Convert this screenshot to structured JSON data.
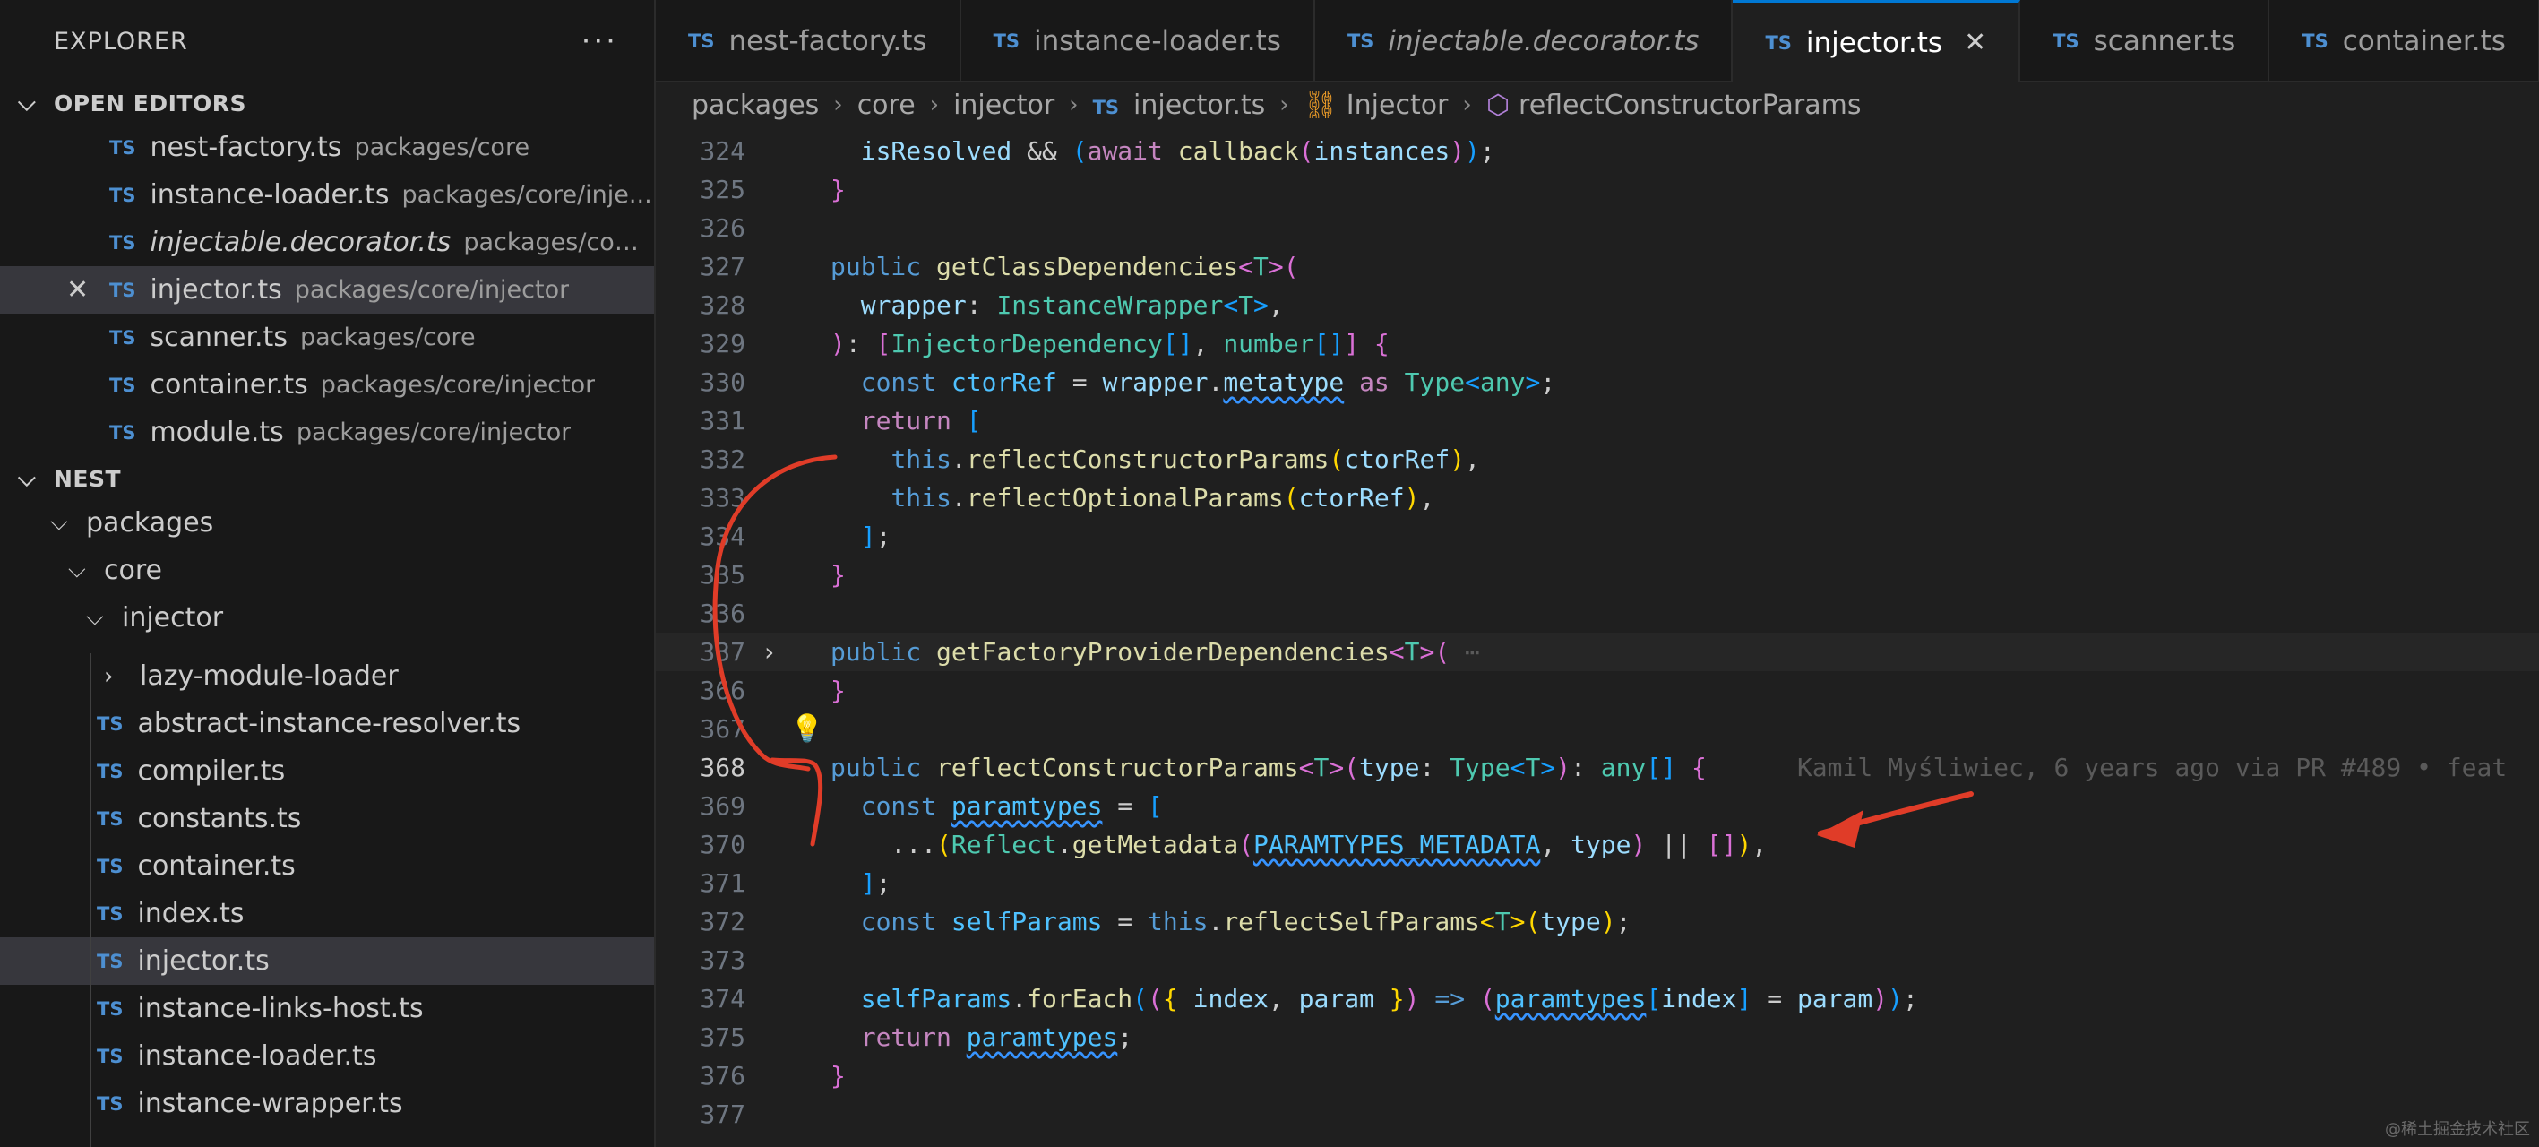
{
  "sidebar": {
    "title": "EXPLORER",
    "more": "···",
    "open_editors": {
      "label": "OPEN EDITORS",
      "items": [
        {
          "name": "nest-factory.ts",
          "path": "packages/core",
          "italic": false,
          "active": false
        },
        {
          "name": "instance-loader.ts",
          "path": "packages/core/inje...",
          "italic": false,
          "active": false
        },
        {
          "name": "injectable.decorator.ts",
          "path": "packages/com...",
          "italic": true,
          "active": false
        },
        {
          "name": "injector.ts",
          "path": "packages/core/injector",
          "italic": false,
          "active": true
        },
        {
          "name": "scanner.ts",
          "path": "packages/core",
          "italic": false,
          "active": false
        },
        {
          "name": "container.ts",
          "path": "packages/core/injector",
          "italic": false,
          "active": false
        },
        {
          "name": "module.ts",
          "path": "packages/core/injector",
          "italic": false,
          "active": false
        }
      ]
    },
    "workspace": {
      "label": "NEST",
      "folders": [
        "packages",
        "core",
        "injector"
      ],
      "subfolder": "lazy-module-loader",
      "files": [
        "abstract-instance-resolver.ts",
        "compiler.ts",
        "constants.ts",
        "container.ts",
        "index.ts",
        "injector.ts",
        "instance-links-host.ts",
        "instance-loader.ts",
        "instance-wrapper.ts"
      ],
      "active_file": "injector.ts"
    },
    "ts_badge": "TS"
  },
  "tabs": [
    {
      "label": "nest-factory.ts",
      "italic": false,
      "active": false
    },
    {
      "label": "instance-loader.ts",
      "italic": false,
      "active": false
    },
    {
      "label": "injectable.decorator.ts",
      "italic": true,
      "active": false
    },
    {
      "label": "injector.ts",
      "italic": false,
      "active": true
    },
    {
      "label": "scanner.ts",
      "italic": false,
      "active": false
    },
    {
      "label": "container.ts",
      "italic": false,
      "active": false
    }
  ],
  "breadcrumb": [
    "packages",
    "core",
    "injector",
    "injector.ts",
    "Injector",
    "reflectConstructorParams"
  ],
  "editor": {
    "current_line": 368,
    "lines": [
      {
        "n": 324,
        "html": "  <span class='vr'>isResolved</span> &amp;&amp; <span class='pb'>(</span><span class='kw2'>await</span> <span class='fn'>callback</span><span class='pn'>(</span><span class='vr'>instances</span><span class='pn'>)</span><span class='pb'>)</span>;"
      },
      {
        "n": 325,
        "html": "<span class='pn'>}</span>"
      },
      {
        "n": 326,
        "html": ""
      },
      {
        "n": 327,
        "html": "<span class='kw'>public</span> <span class='fn'>getClassDependencies</span><span class='pn'>&lt;</span><span class='tp'>T</span><span class='pn'>&gt;(</span>"
      },
      {
        "n": 328,
        "html": "  <span class='vr'>wrapper</span>: <span class='tp'>InstanceWrapper</span><span class='pb'>&lt;</span><span class='tp'>T</span><span class='pb'>&gt;</span>,"
      },
      {
        "n": 329,
        "html": "<span class='pn'>)</span>: <span class='pn'>[</span><span class='tp'>InjectorDependency</span><span class='pb'>[]</span>, <span class='tp'>number</span><span class='pb'>[]</span><span class='pn'>]</span> <span class='pn'>{</span>"
      },
      {
        "n": 330,
        "html": "  <span class='kw'>const</span> <span class='cn'>ctorRef</span> = <span class='vr'>wrapper</span>.<span class='vr sq'>metatype</span> <span class='kw2'>as</span> <span class='tp'>Type</span><span class='pb'>&lt;</span><span class='tp'>any</span><span class='pb'>&gt;</span>;"
      },
      {
        "n": 331,
        "html": "  <span class='kw2'>return</span> <span class='pb'>[</span>"
      },
      {
        "n": 332,
        "html": "    <span class='kw'>this</span>.<span class='fn'>reflectConstructorParams</span><span class='py'>(</span><span class='vr'>ctorRef</span><span class='py'>)</span>,"
      },
      {
        "n": 333,
        "html": "    <span class='kw'>this</span>.<span class='fn'>reflectOptionalParams</span><span class='py'>(</span><span class='vr'>ctorRef</span><span class='py'>)</span>,"
      },
      {
        "n": 334,
        "html": "  <span class='pb'>]</span>;"
      },
      {
        "n": 335,
        "html": "<span class='pn'>}</span>"
      },
      {
        "n": 336,
        "html": ""
      },
      {
        "n": 337,
        "html": "<span class='kw'>public</span> <span class='fn'>getFactoryProviderDependencies</span><span class='pn'>&lt;</span><span class='tp'>T</span><span class='pn'>&gt;(</span> <span class='inline-blame'>⋯</span>",
        "fold": true,
        "hl": true
      },
      {
        "n": 366,
        "html": "<span class='pn'>}</span>"
      },
      {
        "n": 367,
        "html": "",
        "bulb": true
      },
      {
        "n": 368,
        "html": "<span class='kw'>public</span> <span class='fn'>reflectConstructorParams</span><span class='pn'>&lt;</span><span class='tp'>T</span><span class='pn'>&gt;(</span><span class='vr'>type</span>: <span class='tp'>Type</span><span class='pb'>&lt;</span><span class='tp'>T</span><span class='pb'>&gt;</span><span class='pn'>)</span>: <span class='tp'>any</span><span class='pb'>[]</span> <span class='pn'>{</span>      <span class='inline-blame'>Kamil Myśliwiec, 6 years ago via PR #489 • feat</span>"
      },
      {
        "n": 369,
        "html": "  <span class='kw'>const</span> <span class='cn sq'>paramtypes</span> = <span class='pb'>[</span>"
      },
      {
        "n": 370,
        "html": "    ...<span class='py'>(</span><span class='tp'>Reflect</span>.<span class='fn'>getMetadata</span><span class='pn'>(</span><span class='cn sq'>PARAMTYPES_METADATA</span>, <span class='vr'>type</span><span class='pn'>)</span> || <span class='pn'>[]</span><span class='py'>)</span>,"
      },
      {
        "n": 371,
        "html": "  <span class='pb'>]</span>;"
      },
      {
        "n": 372,
        "html": "  <span class='kw'>const</span> <span class='cn'>selfParams</span> = <span class='kw'>this</span>.<span class='fn'>reflectSelfParams</span><span class='py'>&lt;</span><span class='tp'>T</span><span class='py'>&gt;</span><span class='py'>(</span><span class='vr'>type</span><span class='py'>)</span>;"
      },
      {
        "n": 373,
        "html": ""
      },
      {
        "n": 374,
        "html": "  <span class='cn'>selfParams</span>.<span class='fn'>forEach</span><span class='pb'>(</span><span class='pn'>(</span><span class='py'>{</span> <span class='vr'>index</span>, <span class='vr'>param</span> <span class='py'>}</span><span class='pn'>)</span> <span class='kw'>=&gt;</span> <span class='pn'>(</span><span class='cn sq'>paramtypes</span><span class='pb'>[</span><span class='vr'>index</span><span class='pb'>]</span> = <span class='vr'>param</span><span class='pn'>)</span><span class='pb'>)</span>;"
      },
      {
        "n": 375,
        "html": "  <span class='kw2'>return</span> <span class='cn sq'>paramtypes</span>;"
      },
      {
        "n": 376,
        "html": "<span class='pn'>}</span>"
      },
      {
        "n": 377,
        "html": ""
      }
    ]
  },
  "watermark": "@稀土掘金技术社区",
  "colors": {
    "annotation": "#e03c28",
    "ts_badge": "#4d8fd1",
    "active_tab_border": "#0078d4"
  }
}
